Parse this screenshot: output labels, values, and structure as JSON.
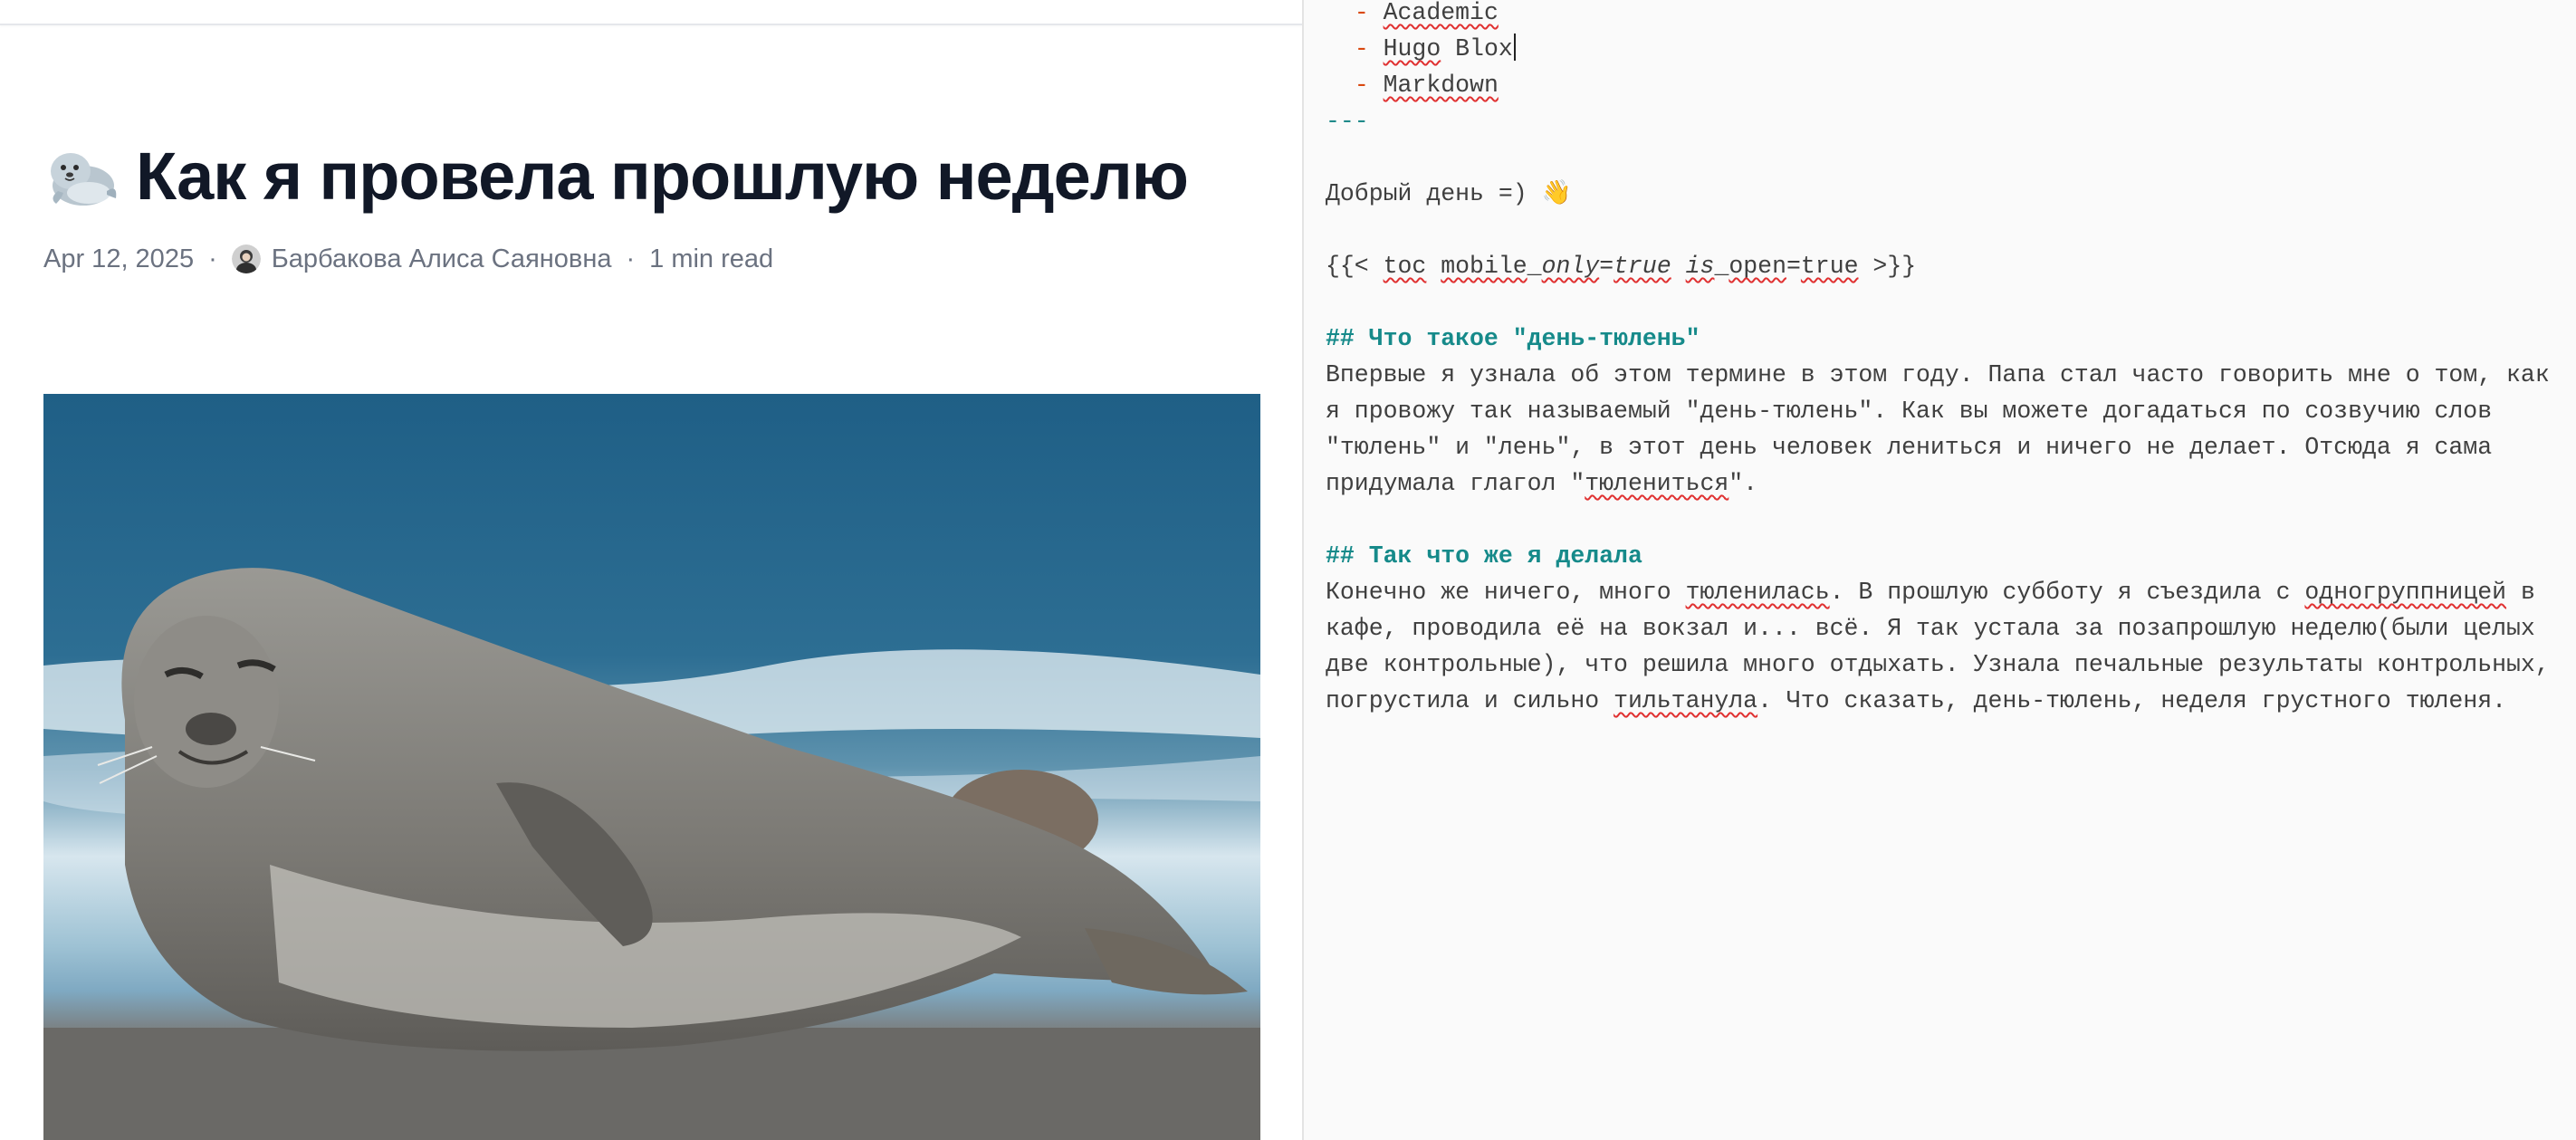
{
  "preview": {
    "title": "Как я провела прошлую неделю",
    "title_emoji": "seal-emoji",
    "meta": {
      "date": "Apr 12, 2025",
      "separator": "·",
      "author": "Барбакова Алиса Саяновна",
      "read_time": "1 min read"
    },
    "featured_image_alt": "seal lying on a beach"
  },
  "editor": {
    "tags": {
      "dash": "-",
      "items": [
        "Academic",
        "Hugo",
        "Blox",
        "Markdown"
      ]
    },
    "frontmatter_end": "---",
    "greeting": "Добрый день =) 👋",
    "shortcode": {
      "open": "{{<",
      "name": "toc",
      "param1_key": "mobile",
      "param1_sep": "_",
      "param1_key2": "only",
      "param1_value": "true",
      "param2_key": "is",
      "param2_sep": "_",
      "param2_key2": "open",
      "param2_value": "true",
      "close": ">}}",
      "equals": "="
    },
    "section1": {
      "heading": "## Что такое \"день-тюлень\"",
      "lines": [
        "Впервые я узнала об этом термине в этом году. Папа стал часто говорить мне о том, как",
        "я провожу так называемый \"день-тюлень\". Как вы можете догадаться по созвучию слов",
        "\"тюлень\" и \"лень\", в этот день человек лениться и ничего не делает. Отсюда я сама"
      ],
      "last_line_prefix": "придумала глагол \"",
      "last_line_word": "тюлениться",
      "last_line_suffix": "\"."
    },
    "section2": {
      "heading": "## Так что же я делала",
      "line1_a": "Конечно же ничего, много ",
      "line1_word1": "тюленилась",
      "line1_b": ". В прошлую субботу я съездила с ",
      "line1_word2": "одногруппницей",
      "line1_c": " в",
      "line2": "кафе, проводила её на вокзал и... всё. Я так устала за позапрошлую неделю(были целых",
      "line3": "две контрольные), что решила много отдыхать. Узнала печальные результаты контрольных,",
      "line4_a": "погрустила и сильно ",
      "line4_word": "тильтанула",
      "line4_b": ". Что сказать, день-тюлень, неделя грустного тюленя."
    }
  }
}
